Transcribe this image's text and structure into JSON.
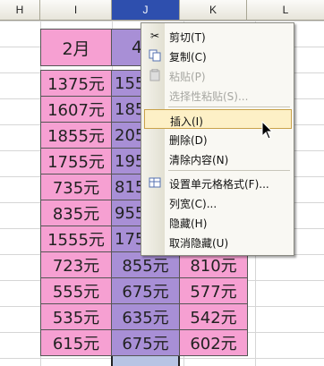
{
  "columns": {
    "h": "H",
    "i": "I",
    "j": "J",
    "k": "K",
    "l": "L"
  },
  "header_row": {
    "i": "2月",
    "j": "4"
  },
  "rows": [
    {
      "i": "1375元",
      "j": "155",
      "k": ""
    },
    {
      "i": "1607元",
      "j": "185",
      "k": ""
    },
    {
      "i": "1855元",
      "j": "205",
      "k": ""
    },
    {
      "i": "1755元",
      "j": "195",
      "k": ""
    },
    {
      "i": "735元",
      "j": "815",
      "k": ""
    },
    {
      "i": "835元",
      "j": "955",
      "k": ""
    },
    {
      "i": "1555元",
      "j": "175",
      "k": ""
    },
    {
      "i": "723元",
      "j": "855元",
      "k": "810元"
    },
    {
      "i": "555元",
      "j": "675元",
      "k": "577元"
    },
    {
      "i": "535元",
      "j": "635元",
      "k": "542元"
    },
    {
      "i": "615元",
      "j": "675元",
      "k": "602元"
    }
  ],
  "context_menu": {
    "cut": "剪切(T)",
    "copy": "复制(C)",
    "paste": "粘贴(P)",
    "paste_special": "选择性粘贴(S)...",
    "insert": "插入(I)",
    "delete": "删除(D)",
    "clear_contents": "清除内容(N)",
    "format_cells": "设置单元格格式(F)...",
    "column_width": "列宽(C)...",
    "hide": "隐藏(H)",
    "unhide": "取消隐藏(U)"
  },
  "colors": {
    "pink": "#f6a0d2",
    "purple": "#a88fd6",
    "selected_header": "#2e4fae",
    "menu_hover": "#fdf0c6"
  }
}
